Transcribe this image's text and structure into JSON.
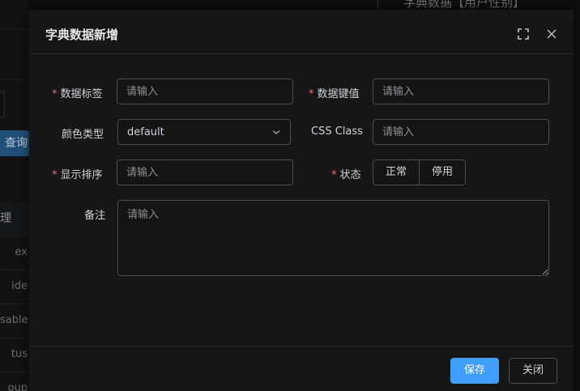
{
  "background": {
    "top_title": "字典数据【用户性别】",
    "query_button": "查询",
    "input_fragment": "]",
    "table_header_fragment": "理",
    "table_rows": [
      "ex",
      "ide",
      "sable",
      "tus",
      "oup"
    ]
  },
  "dialog": {
    "title": "字典数据新增",
    "fullscreen_icon": "fullscreen-icon",
    "close_icon": "close-icon",
    "fields": {
      "label": {
        "label": "数据标签",
        "required_mark": "*",
        "placeholder": "请输入",
        "value": ""
      },
      "value": {
        "label": "数据键值",
        "required_mark": "*",
        "placeholder": "请输入",
        "value": ""
      },
      "color_type": {
        "label": "颜色类型",
        "selected": "default"
      },
      "css_class": {
        "label": "CSS Class",
        "placeholder": "请输入",
        "value": ""
      },
      "sort": {
        "label": "显示排序",
        "required_mark": "*",
        "placeholder": "请输入",
        "value": ""
      },
      "status": {
        "label": "状态",
        "required_mark": "*",
        "options": [
          "正常",
          "停用"
        ]
      },
      "remark": {
        "label": "备注",
        "placeholder": "请输入",
        "value": ""
      }
    },
    "footer": {
      "save_label": "保存",
      "close_label": "关闭"
    }
  },
  "colors": {
    "primary": "#409eff",
    "required": "#f56c6c",
    "dialog_bg": "#161617",
    "border": "#4c4d4f"
  }
}
